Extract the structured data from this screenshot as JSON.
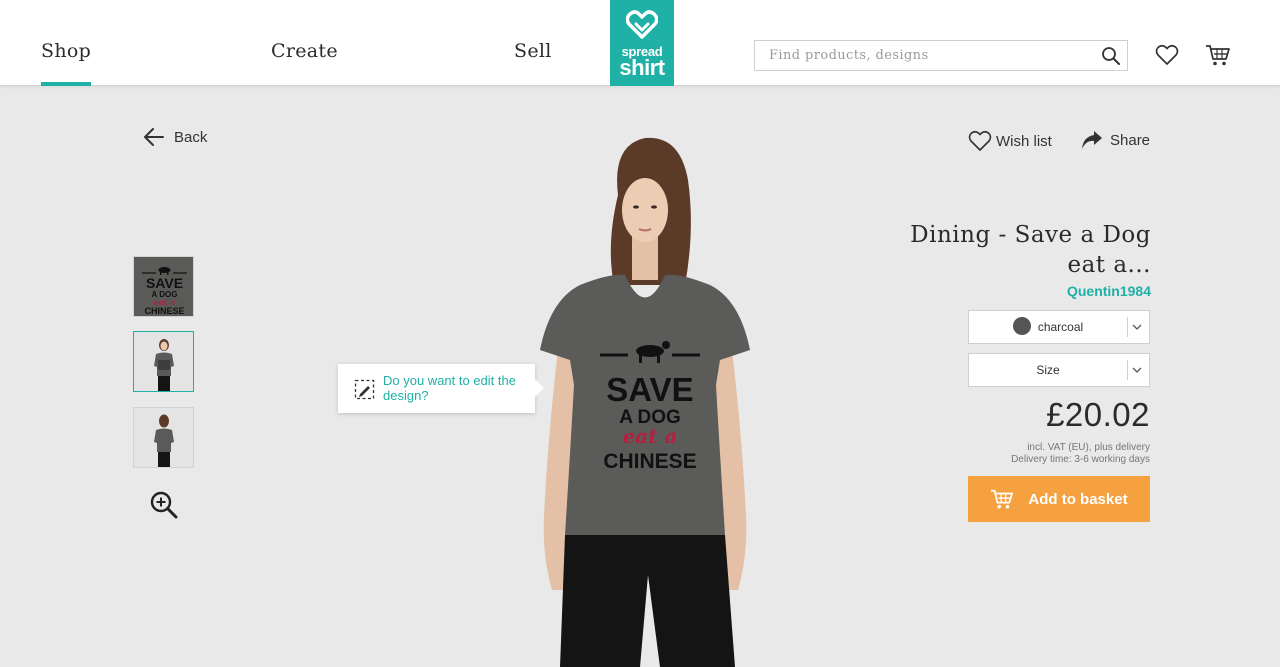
{
  "header": {
    "nav": {
      "shop": "Shop",
      "create": "Create",
      "sell": "Sell"
    },
    "logo": {
      "line1": "spread",
      "line2": "shirt"
    },
    "search": {
      "placeholder": "Find products, designs",
      "value": ""
    }
  },
  "back_label": "Back",
  "tooltip": {
    "text": "Do you want to edit the design?"
  },
  "actions": {
    "wish_list": "Wish list",
    "share": "Share"
  },
  "product": {
    "title": "Dining - Save a Dog eat a...",
    "designer": "Quentin1984",
    "color": {
      "label": "charcoal",
      "swatch": "#555555"
    },
    "size": {
      "label": "Size"
    },
    "price": "£20.02",
    "vat_note": "incl. VAT (EU), plus delivery",
    "delivery": "Delivery time: 3-6 working days",
    "add_to_basket": "Add to basket"
  },
  "design_text": {
    "line1": "SAVE",
    "line2": "A DOG",
    "line3": "eat a",
    "line4": "CHINESE"
  },
  "colors": {
    "accent": "#1fb0a6",
    "basket": "#f5a140",
    "shirt": "#5a5a58"
  }
}
